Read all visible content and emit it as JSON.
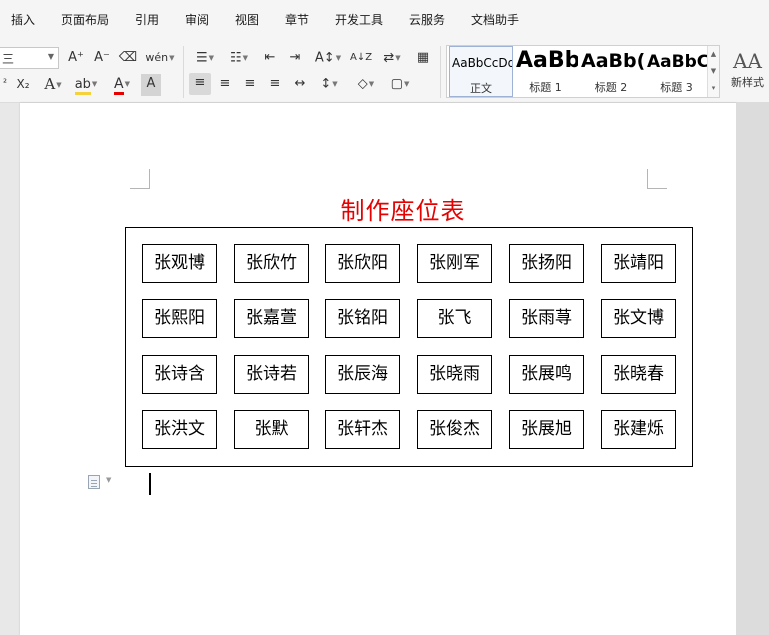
{
  "menu_tabs": [
    "插入",
    "页面布局",
    "引用",
    "审阅",
    "视图",
    "章节",
    "开发工具",
    "云服务",
    "文档助手"
  ],
  "ribbon": {
    "font_size_value": "三",
    "row1": {
      "grow_font": "A⁺",
      "shrink_font": "A⁻",
      "clear_format": "⌫",
      "phonetic": "wén",
      "bullets": "☰",
      "numbering": "☷",
      "decrease_indent": "⇤",
      "increase_indent": "⇥",
      "convert": "A↕",
      "sort": "A↓Z",
      "show_marks": "⇄",
      "table_tool": "▦"
    },
    "row2": {
      "superscript": "²",
      "subscript": "X₂",
      "text_effect": "A",
      "highlight": "ab",
      "font_color": "A",
      "char_shading": "A",
      "align_left": "≡",
      "align_center": "≡",
      "align_right": "≡",
      "justify": "≡",
      "distribute": "↔",
      "line_spacing": "↕",
      "shading": "◇",
      "borders": "▢"
    },
    "styles": [
      {
        "preview": "AaBbCcDd",
        "name": "正文"
      },
      {
        "preview": "AaBb",
        "name": "标题 1"
      },
      {
        "preview": "AaBb(",
        "name": "标题 2"
      },
      {
        "preview": "AaBbC",
        "name": "标题 3"
      }
    ],
    "gallery_scroll": [
      "▲",
      "▼",
      "▾"
    ],
    "new_style_icon": "AA",
    "new_style_label": "新样式"
  },
  "document": {
    "title": "制作座位表",
    "title_color": "#e60000",
    "seats": [
      [
        "张观博",
        "张欣竹",
        "张欣阳",
        "张刚军",
        "张扬阳",
        "张靖阳"
      ],
      [
        "张熙阳",
        "张嘉萱",
        "张铭阳",
        "张飞",
        "张雨荨",
        "张文博"
      ],
      [
        "张诗含",
        "张诗若",
        "张辰海",
        "张晓雨",
        "张展鸣",
        "张晓春"
      ],
      [
        "张洪文",
        "张默",
        "张轩杰",
        "张俊杰",
        "张展旭",
        "张建烁"
      ]
    ]
  }
}
